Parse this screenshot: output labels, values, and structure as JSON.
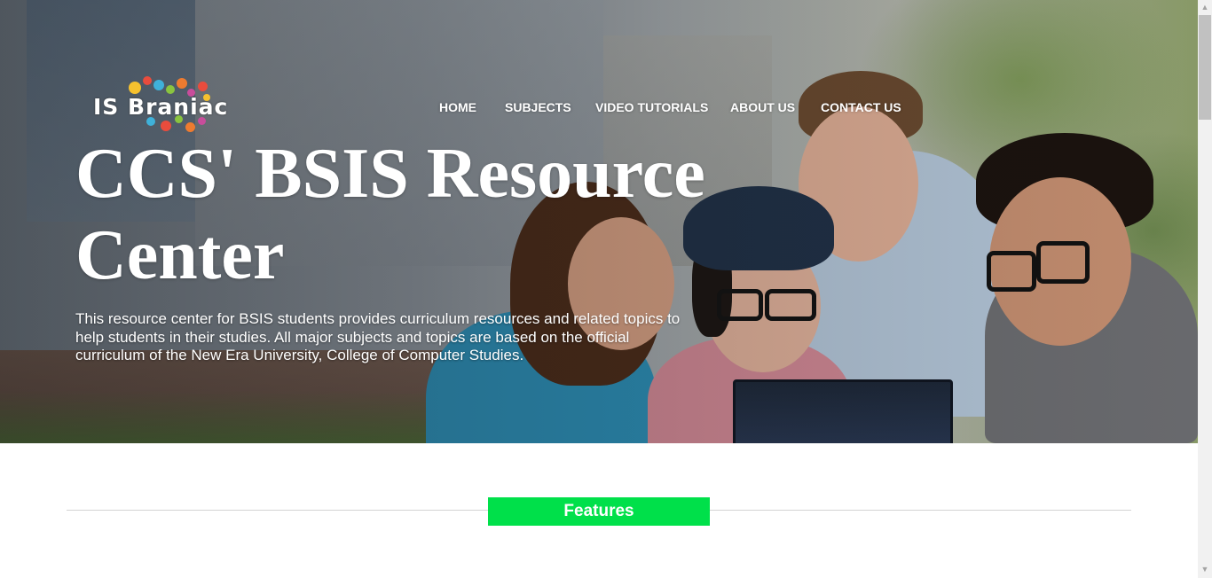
{
  "logo": {
    "text": "IS Braniac"
  },
  "nav": {
    "items": [
      {
        "label": "HOME"
      },
      {
        "label": "SUBJECTS"
      },
      {
        "label": "VIDEO TUTORIALS"
      },
      {
        "label": "ABOUT US"
      },
      {
        "label": "CONTACT US"
      }
    ]
  },
  "hero": {
    "title": "CCS' BSIS Resource Center",
    "description": "This resource center for BSIS students provides curriculum resources and related topics to help students in their studies. All major subjects and topics are based on the official curriculum of the New Era University, College of Computer Studies."
  },
  "features": {
    "label": "Features"
  },
  "colors": {
    "features_accent": "#00e04a",
    "text_light": "#ffffff",
    "divider": "#d4d4d4"
  },
  "icons": {
    "scroll_up": "triangle-up-icon",
    "scroll_down": "triangle-down-icon"
  }
}
